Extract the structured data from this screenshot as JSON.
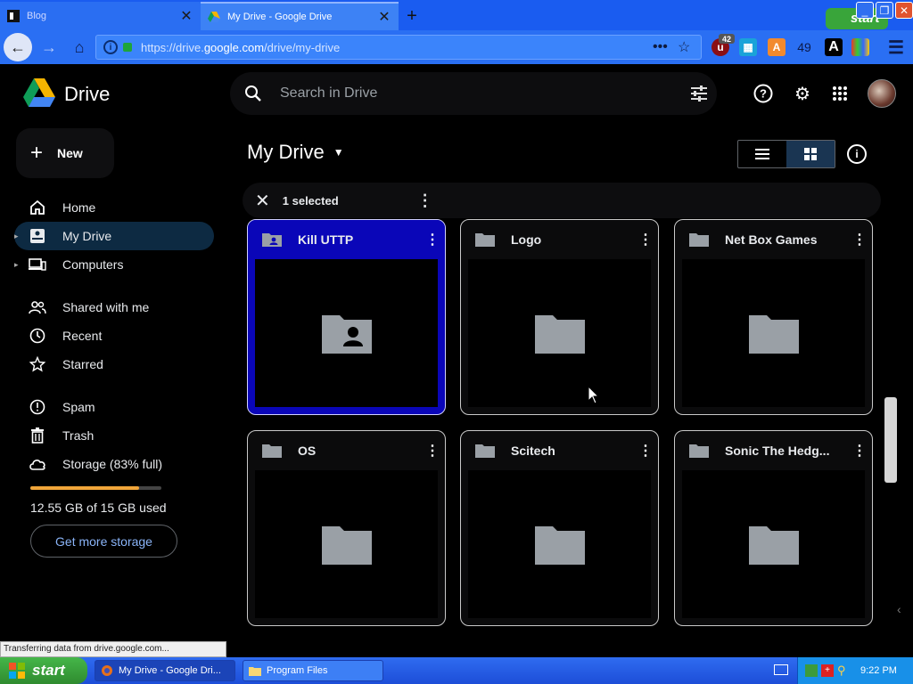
{
  "browser": {
    "tabs": [
      {
        "title": "Blog",
        "active": false
      },
      {
        "title": "My Drive - Google Drive",
        "active": true
      }
    ],
    "url_prefix": "https://drive.",
    "url_domain": "google.com",
    "url_path": "/drive/my-drive",
    "extensions": {
      "ublock_badge": "42",
      "counter": "49",
      "font_icon": "A"
    },
    "window_start_label": "start",
    "status_text": "Transferring data from drive.google.com..."
  },
  "drive": {
    "product": "Drive",
    "search_placeholder": "Search in Drive",
    "new_label": "New",
    "sidebar": [
      {
        "label": "Home",
        "icon": "home-icon"
      },
      {
        "label": "My Drive",
        "icon": "my-drive-icon",
        "active": true
      },
      {
        "label": "Computers",
        "icon": "computers-icon"
      },
      {
        "label": "Shared with me",
        "icon": "shared-icon"
      },
      {
        "label": "Recent",
        "icon": "clock-icon"
      },
      {
        "label": "Starred",
        "icon": "star-icon"
      },
      {
        "label": "Spam",
        "icon": "spam-icon"
      },
      {
        "label": "Trash",
        "icon": "trash-icon"
      },
      {
        "label": "Storage (83% full)",
        "icon": "cloud-icon"
      }
    ],
    "storage_fraction": 0.83,
    "storage_used_text": "12.55 GB of 15 GB used",
    "get_more_storage": "Get more storage",
    "page_title": "My Drive",
    "selection_text": "1 selected",
    "folders": [
      {
        "name": "Kill UTTP",
        "shared": true,
        "selected": true
      },
      {
        "name": "Logo",
        "shared": false,
        "selected": false
      },
      {
        "name": "Net Box Games",
        "shared": false,
        "selected": false
      },
      {
        "name": "OS",
        "shared": false,
        "selected": false
      },
      {
        "name": "Scitech",
        "shared": false,
        "selected": false
      },
      {
        "name": "Sonic The Hedg...",
        "shared": false,
        "selected": false
      }
    ]
  },
  "taskbar": {
    "start": "start",
    "tasks": [
      {
        "title": "My Drive - Google Dri...",
        "active": true
      },
      {
        "title": "Program Files",
        "active": false
      }
    ],
    "clock": "9:22 PM"
  },
  "colors": {
    "accent": "#8ab4f8",
    "selected_card": "#0a06b8",
    "storage_fill": "#f0a53a"
  }
}
